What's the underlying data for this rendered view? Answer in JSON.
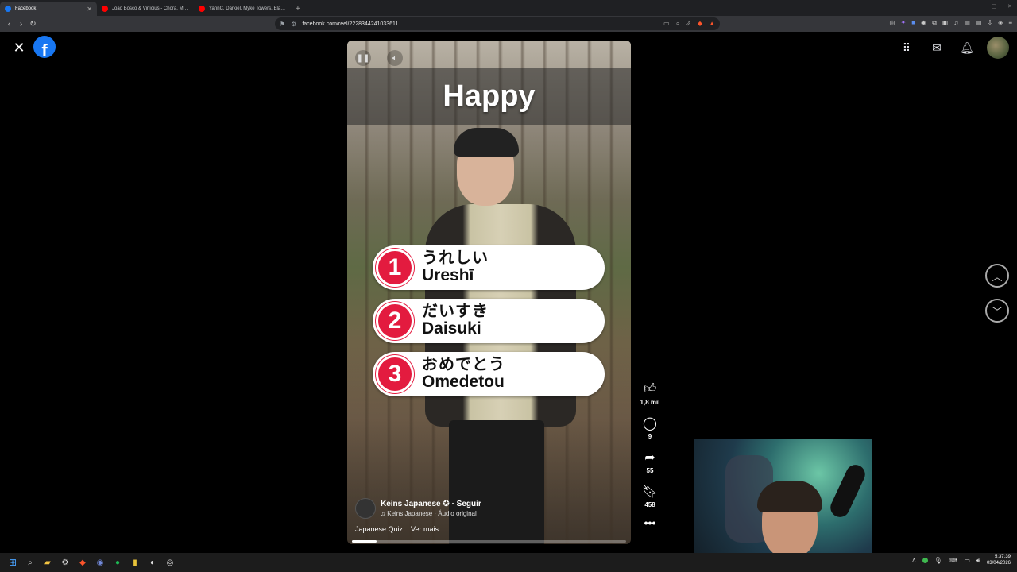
{
  "browser": {
    "tabs": [
      {
        "title": "Facebook",
        "favicon_color": "#1877f2",
        "active": true
      },
      {
        "title": "João Bosco & Vinícius - Chora, Me Li",
        "favicon_color": "#ff0000",
        "active": false
      },
      {
        "title": "YannC, Darkiel, Myke Towers, Eladio",
        "favicon_color": "#ff0000",
        "active": false
      }
    ],
    "close_tab_glyph": "✕",
    "new_tab_glyph": "+",
    "url": "facebook.com/reel/2228344241033611"
  },
  "facebook": {
    "logo_letter": "f",
    "close_glyph": "✕",
    "topbar_icons": [
      "grid-menu",
      "messenger",
      "notifications",
      "profile"
    ]
  },
  "reel": {
    "title": "Happy",
    "items": [
      {
        "num": "1",
        "jp": "うれしい",
        "romaji": "Ureshī"
      },
      {
        "num": "2",
        "jp": "だいすき",
        "romaji": "Daisuki"
      },
      {
        "num": "3",
        "jp": "おめでとう",
        "romaji": "Omedetou"
      }
    ],
    "author": {
      "name": "Keins Japanese",
      "verified": "✪",
      "follow": "· Seguir"
    },
    "audio": "Keins Japanese · Áudio original",
    "caption": "Japanese Quiz... Ver mais",
    "progress": 0.09
  },
  "actions": {
    "likes": "1,8 mil",
    "comments": "9",
    "shares": "55",
    "saves": "458",
    "more": "•••"
  },
  "taskbar": {
    "time": "5:37:39",
    "date": "03/04/2026"
  },
  "colors": {
    "facebook_blue": "#1877f2",
    "quiz_red": "#e31b3f",
    "browser_dark": "#35363a"
  }
}
